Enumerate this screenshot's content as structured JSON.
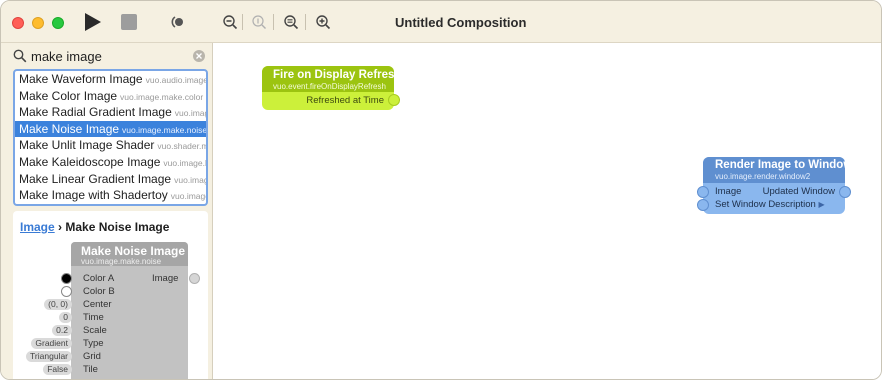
{
  "window": {
    "title": "Untitled Composition"
  },
  "toolbar": {
    "buttons": [
      {
        "name": "play",
        "icon": "play-icon"
      },
      {
        "name": "stop",
        "icon": "stop-icon"
      },
      {
        "name": "broadcast",
        "icon": "broadcast-icon"
      },
      {
        "name": "zoom-out",
        "icon": "zoom-out-icon"
      },
      {
        "name": "zoom-actual",
        "icon": "zoom-actual-icon"
      },
      {
        "name": "zoom-fit",
        "icon": "zoom-fit-icon"
      },
      {
        "name": "zoom-in",
        "icon": "zoom-in-icon"
      }
    ]
  },
  "library": {
    "search": {
      "value": "make image",
      "placeholder": ""
    },
    "results": [
      {
        "title": "Make Waveform Image",
        "class": "vuo.audio.image.waveform"
      },
      {
        "title": "Make Color Image",
        "class": "vuo.image.make.color"
      },
      {
        "title": "Make Radial Gradient Image",
        "class": "vuo.image.make.gradient.radial"
      },
      {
        "title": "Make Noise Image",
        "class": "vuo.image.make.noise",
        "selected": true
      },
      {
        "title": "Make Unlit Image Shader",
        "class": "vuo.shader.make.image.unlit"
      },
      {
        "title": "Make Kaleidoscope Image",
        "class": "vuo.image.kaleidoscope"
      },
      {
        "title": "Make Linear Gradient Image",
        "class": "vuo.image.make.gradient.linear"
      },
      {
        "title": "Make Image with Shadertoy",
        "class": "vuo.image.make.shadertoy"
      }
    ],
    "details": {
      "breadcrumb_link": "Image",
      "breadcrumb_sep": "›",
      "breadcrumb_title": "Make Noise Image",
      "node": {
        "title": "Make Noise Image",
        "class": "vuo.image.make.noise",
        "output": "Image",
        "inputs": [
          {
            "label": "Color A",
            "value": "",
            "swatch": "#000000"
          },
          {
            "label": "Color B",
            "value": "",
            "swatch": "#ffffff"
          },
          {
            "label": "Center",
            "value": "(0, 0)"
          },
          {
            "label": "Time",
            "value": "0"
          },
          {
            "label": "Scale",
            "value": "0.2"
          },
          {
            "label": "Type",
            "value": "Gradient"
          },
          {
            "label": "Grid",
            "value": "Triangular"
          },
          {
            "label": "Tile",
            "value": "False"
          }
        ]
      }
    }
  },
  "canvas": {
    "nodes": [
      {
        "id": "fire",
        "title": "Fire on Display Refresh",
        "class": "vuo.event.fireOnDisplayRefresh",
        "outputs": [
          "Refreshed at Time"
        ],
        "colors": {
          "header": "#9cc410",
          "body": "#ccf03a"
        }
      },
      {
        "id": "render",
        "title": "Render Image to Window",
        "class": "vuo.image.render.window2",
        "inputs": [
          "Image",
          "Set Window Description"
        ],
        "outputs": [
          "Updated Window"
        ],
        "colors": {
          "header": "#5f8fd0",
          "body": "#8ab7ee"
        }
      }
    ]
  }
}
